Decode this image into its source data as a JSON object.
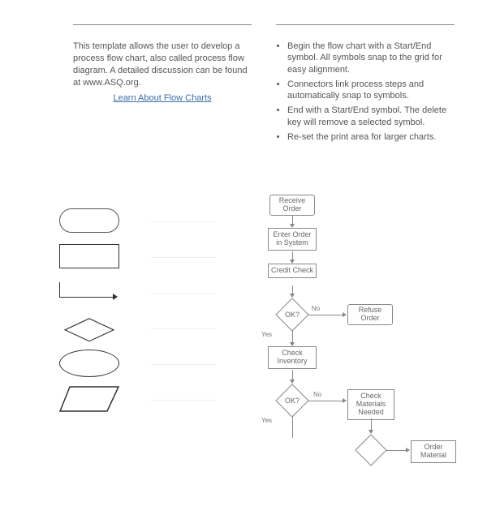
{
  "header": {
    "left_head": "",
    "right_head": "",
    "description": "This template allows the user to develop a process flow chart, also called process flow diagram.  A detailed discussion can be found at www.ASQ.org.",
    "link_label": "Learn About Flow Charts"
  },
  "instructions": [
    "Begin the flow chart with a Start/End symbol.  All symbols snap to the grid for easy alignment.",
    "Connectors link process steps and automatically snap to symbols.",
    "End with a Start/End symbol. The delete key will remove a selected symbol.",
    "Re-set the print area for larger charts."
  ],
  "legend": {
    "terminator": "",
    "process": "",
    "connector": "",
    "decision": "",
    "oval": "",
    "data": ""
  },
  "flow": {
    "n1": "Receive Order",
    "n2": "Enter Order in System",
    "n3": "Credit Check",
    "d1": "OK?",
    "d1_no": "No",
    "d1_yes": "Yes",
    "n4": "Refuse Order",
    "n5": "Check Inventory",
    "d2": "OK?",
    "d2_no": "No",
    "d2_yes": "Yes",
    "n6": "Check Materials Needed",
    "d3": "",
    "n7": "Order Material"
  }
}
